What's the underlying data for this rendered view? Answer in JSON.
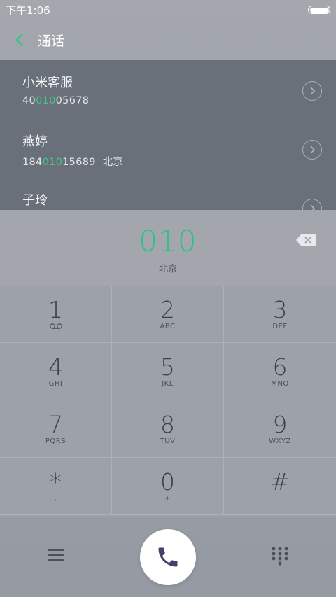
{
  "status_bar": {
    "time": "下午1:06"
  },
  "header": {
    "title": "通话"
  },
  "results": [
    {
      "name": "小米客服",
      "number_pre": "40",
      "number_match": "010",
      "number_post": "05678",
      "location": ""
    },
    {
      "name": "燕婷",
      "number_pre": "184",
      "number_match": "010",
      "number_post": "15689",
      "location": "北京"
    },
    {
      "name": "子玲",
      "number_pre": "",
      "number_match": "",
      "number_post": "",
      "location": ""
    }
  ],
  "entry": {
    "digits": "010",
    "location": "北京"
  },
  "keypad": [
    {
      "num": "1",
      "sub": "voicemail"
    },
    {
      "num": "2",
      "sub": "ABC"
    },
    {
      "num": "3",
      "sub": "DEF"
    },
    {
      "num": "4",
      "sub": "GHI"
    },
    {
      "num": "5",
      "sub": "JKL"
    },
    {
      "num": "6",
      "sub": "MNO"
    },
    {
      "num": "7",
      "sub": "PQRS"
    },
    {
      "num": "8",
      "sub": "TUV"
    },
    {
      "num": "9",
      "sub": "WXYZ"
    },
    {
      "num": "*",
      "sub": ","
    },
    {
      "num": "0",
      "sub": "+"
    },
    {
      "num": "#",
      "sub": ""
    }
  ],
  "colors": {
    "accent": "#2fc083",
    "results_bg": "#6a7079",
    "call_icon": "#4a3d6b"
  }
}
